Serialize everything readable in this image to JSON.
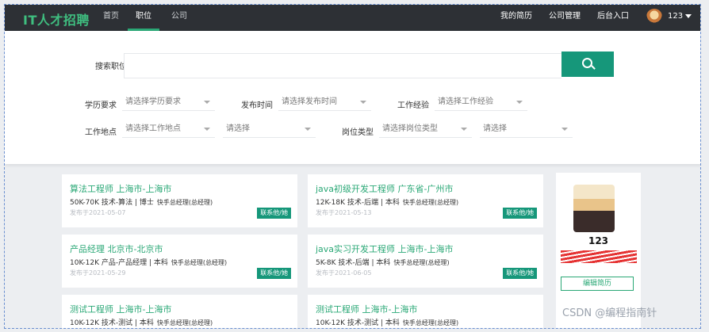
{
  "header": {
    "logo": "IT人才招聘",
    "nav": [
      "首页",
      "职位",
      "公司"
    ],
    "active_nav": "职位",
    "right_links": [
      "我的简历",
      "公司管理",
      "后台入口"
    ],
    "user": "123"
  },
  "filters": {
    "search_label": "搜索职位",
    "education_label": "学历要求",
    "education_placeholder": "请选择学历要求",
    "publish_label": "发布时间",
    "publish_placeholder": "请选择发布时间",
    "experience_label": "工作经验",
    "experience_placeholder": "请选择工作经验",
    "location_label": "工作地点",
    "location_placeholder": "请选择工作地点",
    "location_sub_placeholder": "请选择",
    "jobtype_label": "岗位类型",
    "jobtype_placeholder": "请选择岗位类型",
    "jobtype_sub_placeholder": "请选择"
  },
  "jobs": [
    {
      "title": "算法工程师  上海市-上海市",
      "meta": "50K-70K  技术-算法 | 博士",
      "company": "快手总经理(总经理)",
      "date": "发布于2021-05-07",
      "contact": "联系他/她"
    },
    {
      "title": "java初级开发工程师  广东省-广州市",
      "meta": "12K-18K  技术-后端 | 本科",
      "company": "快手总经理(总经理)",
      "date": "发布于2021-05-13",
      "contact": "联系他/她"
    },
    {
      "title": "产品经理  北京市-北京市",
      "meta": "10K-12K  产品-产品经理 | 本科",
      "company": "快手总经理(总经理)",
      "date": "发布于2021-05-29",
      "contact": "联系他/她"
    },
    {
      "title": "java实习开发工程师  上海市-上海市",
      "meta": "5K-8K  技术-后端 | 本科",
      "company": "快手总经理(总经理)",
      "date": "发布于2021-06-05",
      "contact": "联系他/她"
    },
    {
      "title": "测试工程师  上海市-上海市",
      "meta": "10K-12K  技术-测试 | 本科",
      "company": "快手总经理(总经理)",
      "date": "",
      "contact": ""
    },
    {
      "title": "测试工程师  上海市-上海市",
      "meta": "10K-12K  技术-测试 | 本科",
      "company": "快手总经理(总经理)",
      "date": "",
      "contact": ""
    }
  ],
  "profile": {
    "name": "123",
    "edit_label": "编辑简历"
  },
  "watermark": "CSDN @编程指南针"
}
